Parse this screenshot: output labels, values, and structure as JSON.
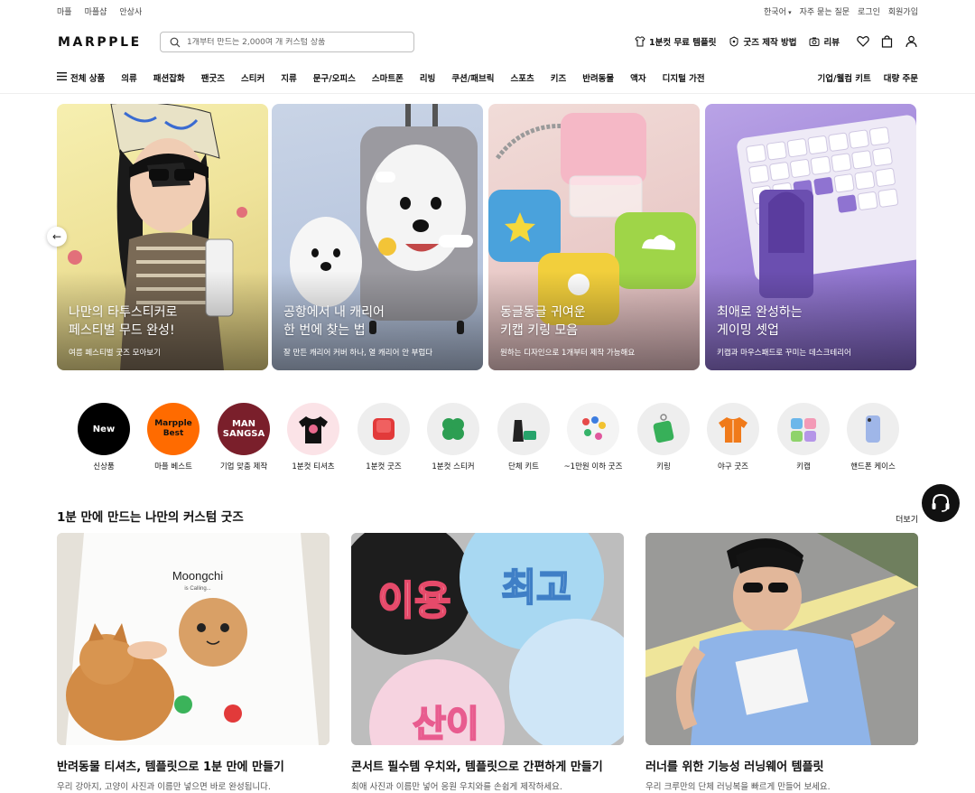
{
  "top_links": {
    "left": [
      "마플",
      "마플샵",
      "안상사"
    ],
    "right": [
      "한국어",
      "자주 묻는 질문",
      "로그인",
      "회원가입"
    ]
  },
  "header": {
    "logo": "MARPPLE",
    "search_placeholder": "1개부터 만드는 2,000여 개 커스텀 상품",
    "template_link": "1분컷 무료 템플릿",
    "guide_link": "굿즈 제작 방법",
    "review_link": "리뷰"
  },
  "nav": {
    "all_label": "전체 상품",
    "items": [
      "의류",
      "패션잡화",
      "팬굿즈",
      "스티커",
      "지류",
      "문구/오피스",
      "스마트폰",
      "리빙",
      "쿠션/패브릭",
      "스포츠",
      "키즈",
      "반려동물",
      "액자",
      "디지털 가전"
    ],
    "right": [
      "기업/웰컴 키트",
      "대량 주문"
    ]
  },
  "banners": [
    {
      "title": "나만의 타투스티커로\n페스티벌 무드 완성!",
      "sub": "여름 페스티벌 굿즈 모아보기"
    },
    {
      "title": "공항에서 내 캐리어\n한 번에 찾는 법",
      "sub": "잘 만든 캐리어 커버 하나, 열 캐리어 안 부럽다"
    },
    {
      "title": "동글동글 귀여운\n키캡 키링 모음",
      "sub": "원하는 디자인으로 1개부터 제작 가능해요"
    },
    {
      "title": "최애로 완성하는\n게이밍 셋업",
      "sub": "키캡과 마우스패드로 꾸미는 데스크테리어"
    }
  ],
  "categories": [
    {
      "label": "신상품",
      "badge": "New"
    },
    {
      "label": "마플 베스트",
      "badge": "Marpple Best"
    },
    {
      "label": "기업 맞춤 제작",
      "badge": "MAN SANGSA"
    },
    {
      "label": "1분컷 티셔츠"
    },
    {
      "label": "1분컷 굿즈"
    },
    {
      "label": "1분컷 스티커"
    },
    {
      "label": "단체 키트"
    },
    {
      "label": "~1만원 이하 굿즈"
    },
    {
      "label": "키링"
    },
    {
      "label": "야구 굿즈"
    },
    {
      "label": "키캡"
    },
    {
      "label": "핸드폰 케이스"
    }
  ],
  "section": {
    "title": "1분 만에 만드는 나만의 커스텀 굿즈",
    "more": "더보기",
    "cards": [
      {
        "title": "반려동물 티셔츠, 템플릿으로 1분 만에 만들기",
        "desc": "우리 강아지, 고양이 사진과 이름만 넣으면 바로 완성됩니다."
      },
      {
        "title": "콘서트 필수템 우치와, 템플릿으로 간편하게 만들기",
        "desc": "최애 사진과 이름만 넣어 응원 우치와를 손쉽게 제작하세요."
      },
      {
        "title": "러너를 위한 기능성 러닝웨어 템플릿",
        "desc": "우리 크루만의 단체 러닝복을 빠르게 만들어 보세요."
      }
    ]
  },
  "card_art": {
    "tshirt_text": "Moongchi",
    "tshirt_sub": "is Calling...",
    "uchiwa_left": "이용",
    "uchiwa_right": "최고",
    "uchiwa_bottom": "산이"
  }
}
